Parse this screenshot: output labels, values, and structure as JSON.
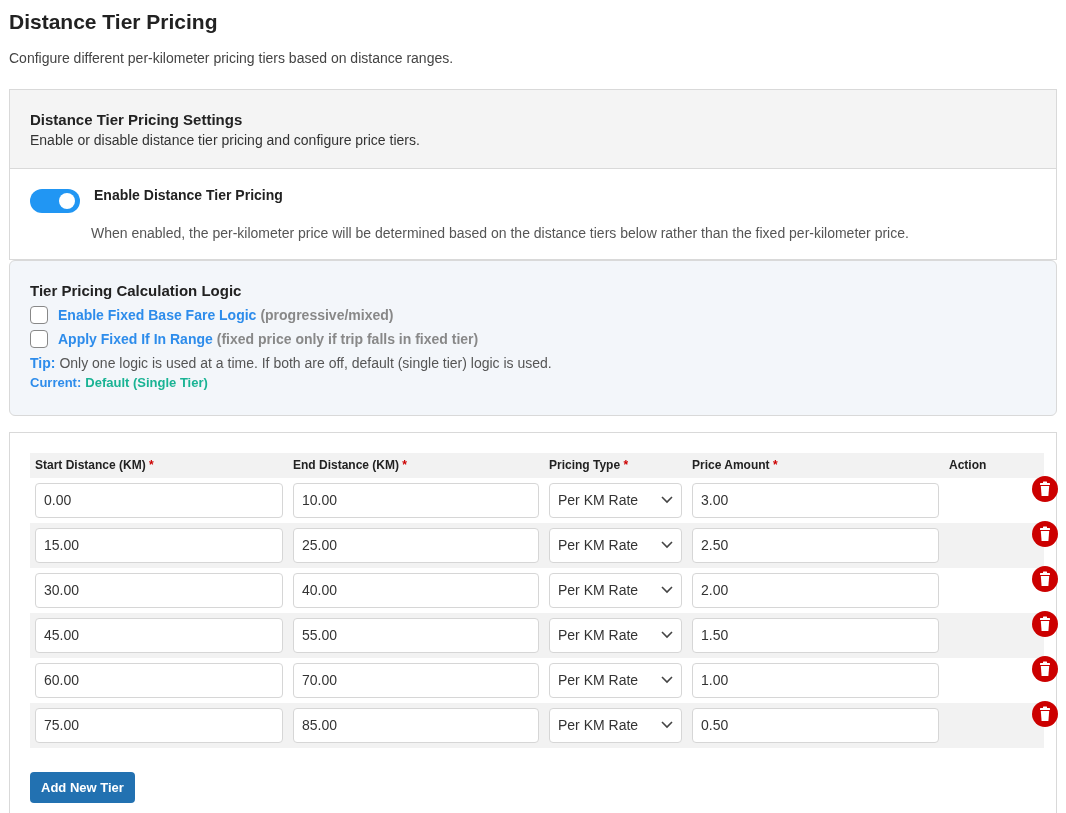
{
  "page": {
    "title": "Distance Tier Pricing",
    "subtitle": "Configure different per-kilometer pricing tiers based on distance ranges."
  },
  "settings": {
    "title": "Distance Tier Pricing Settings",
    "description": "Enable or disable distance tier pricing and configure price tiers.",
    "toggle": {
      "label": "Enable Distance Tier Pricing",
      "on": true,
      "help": "When enabled, the per-kilometer price will be determined based on the distance tiers below rather than the fixed per-kilometer price."
    }
  },
  "logic": {
    "title": "Tier Pricing Calculation Logic",
    "options": [
      {
        "label": "Enable Fixed Base Fare Logic",
        "note": "(progressive/mixed)",
        "checked": false
      },
      {
        "label": "Apply Fixed If In Range",
        "note": "(fixed price only if trip falls in fixed tier)",
        "checked": false
      }
    ],
    "tip_label": "Tip:",
    "tip_text": "Only one logic is used at a time. If both are off, default (single tier) logic is used.",
    "current_label": "Current:",
    "current_value": "Default (Single Tier)"
  },
  "table": {
    "columns": [
      {
        "label": "Start Distance (KM)",
        "required": true
      },
      {
        "label": "End Distance (KM)",
        "required": true
      },
      {
        "label": "Pricing Type",
        "required": true
      },
      {
        "label": "Price Amount",
        "required": true
      },
      {
        "label": "Action",
        "required": false
      }
    ],
    "required_mark": "*",
    "rows": [
      {
        "start": "0.00",
        "end": "10.00",
        "type": "Per KM Rate",
        "price": "3.00"
      },
      {
        "start": "15.00",
        "end": "25.00",
        "type": "Per KM Rate",
        "price": "2.50"
      },
      {
        "start": "30.00",
        "end": "40.00",
        "type": "Per KM Rate",
        "price": "2.00"
      },
      {
        "start": "45.00",
        "end": "55.00",
        "type": "Per KM Rate",
        "price": "1.50"
      },
      {
        "start": "60.00",
        "end": "70.00",
        "type": "Per KM Rate",
        "price": "1.00"
      },
      {
        "start": "75.00",
        "end": "85.00",
        "type": "Per KM Rate",
        "price": "0.50"
      }
    ]
  },
  "add_button": "Add New Tier"
}
